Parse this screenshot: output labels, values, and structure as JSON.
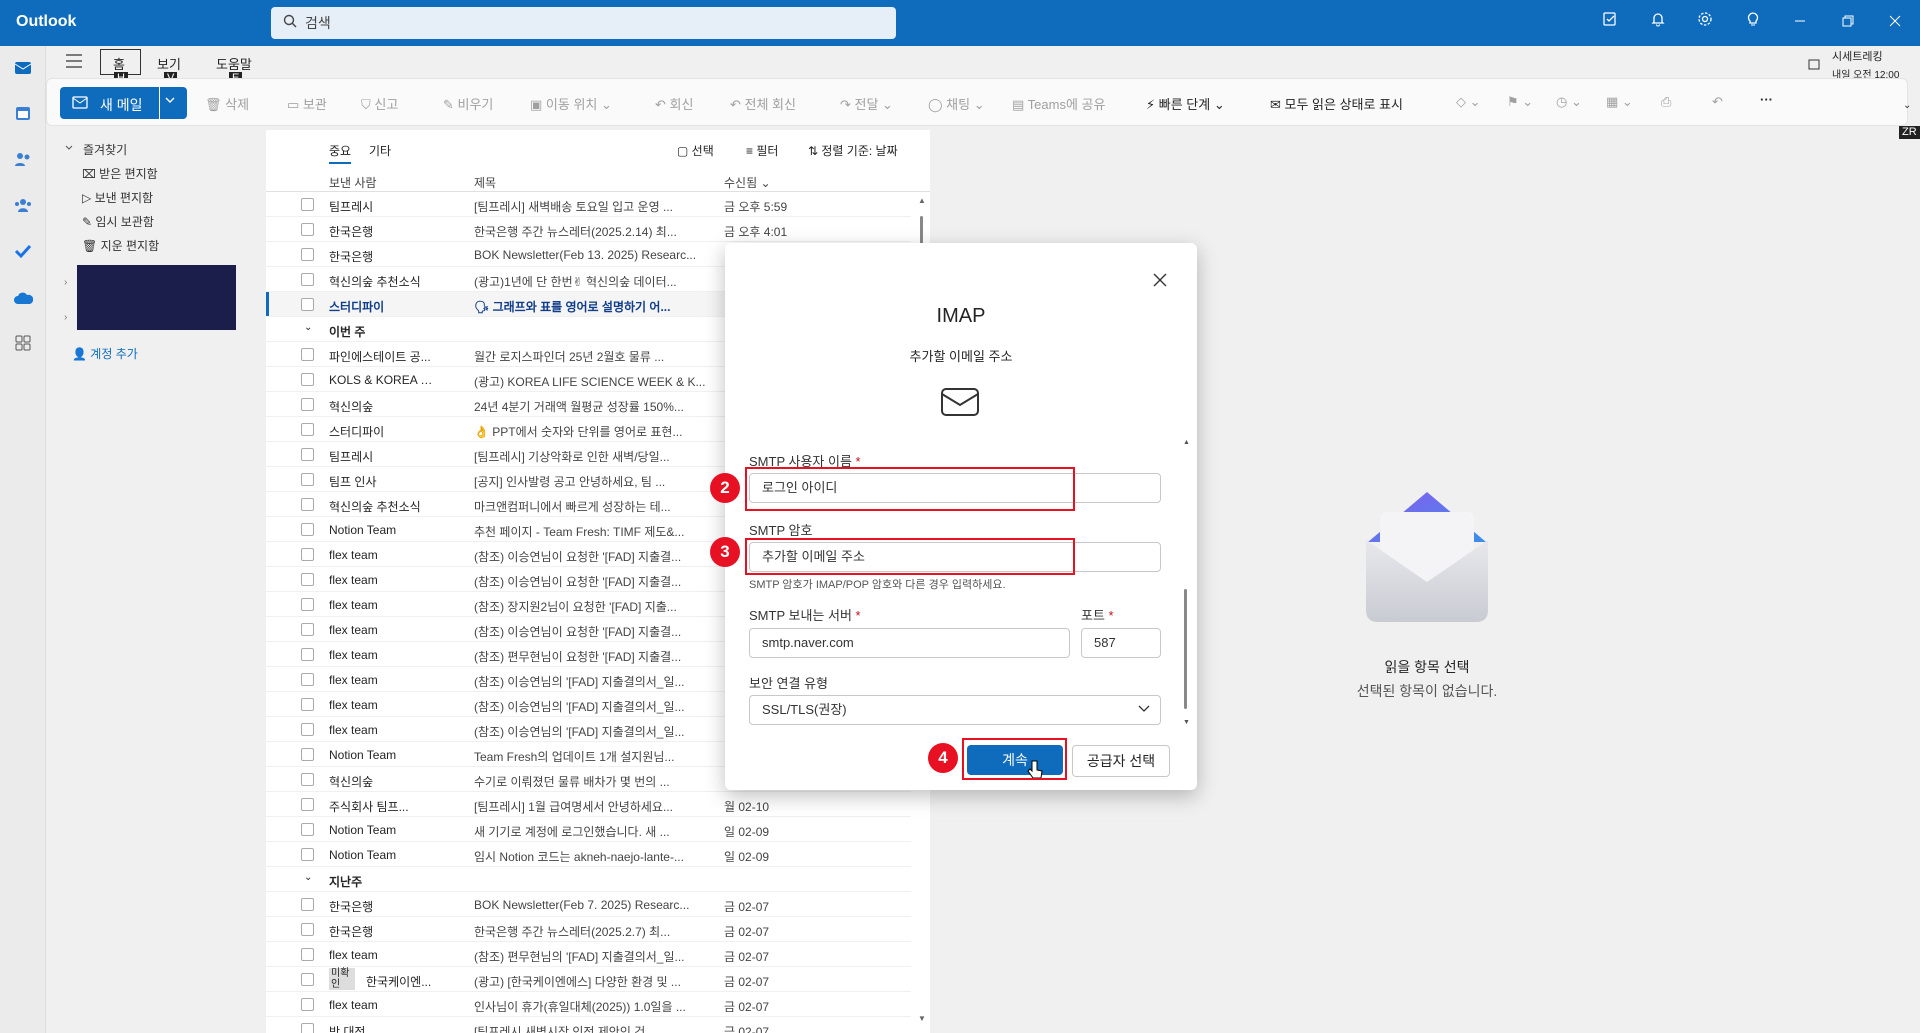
{
  "app": {
    "title": "Outlook"
  },
  "search": {
    "placeholder": "검색"
  },
  "titlebar_icons": [
    "notes-icon",
    "bell-icon",
    "gear-icon",
    "lightbulb-icon",
    "minimize-icon",
    "restore-icon",
    "close-icon"
  ],
  "menu": {
    "home": "홈",
    "home_key": "H",
    "view": "보기",
    "view_key": "V",
    "help": "도움말",
    "help_key": "E",
    "event": "시세트레킹",
    "event_time": "내일 오전 12:00",
    "event_key": "TU",
    "zr_key": "ZR"
  },
  "ribbon": {
    "new_mail": "새 메일",
    "delete": "삭제",
    "archive": "보관",
    "report": "신고",
    "sweep": "비우기",
    "move": "이동 위치",
    "reply": "회신",
    "reply_all": "전체 회신",
    "forward": "전달",
    "chat": "채팅",
    "teams": "Teams에 공유",
    "quick_steps": "빠른 단계",
    "mark_read": "모두 읽은 상태로 표시"
  },
  "folders": {
    "favorites": "즐겨찾기",
    "inbox": "받은 편지함",
    "sent": "보낸 편지함",
    "drafts": "임시 보관함",
    "deleted": "지운 편지함",
    "add_account": "계정 추가"
  },
  "list": {
    "tab_focused": "중요",
    "tab_other": "기타",
    "select": "선택",
    "filter": "필터",
    "sort": "정렬 기준: 날짜",
    "col_from": "보낸 사람",
    "col_subject": "제목",
    "col_received": "수신됨"
  },
  "rows": [
    {
      "from": "팀프레시",
      "subject": "[팀프레시] 새벽배송 토요일 입고 운영 ...",
      "date": "금 오후 5:59"
    },
    {
      "from": "한국은행",
      "subject": "한국은행 주간 뉴스레터(2025.2.14) 최...",
      "date": "금 오후 4:01"
    },
    {
      "from": "한국은행",
      "subject": "BOK Newsletter(Feb 13. 2025) Researc...",
      "date": ""
    },
    {
      "from": "혁신의숲 추천소식",
      "subject": "(광고)1년에 단 한번✌ 혁신의숲 데이터...",
      "date": ""
    },
    {
      "from": "스터디파이",
      "subject": "🗣 그래프와 표를 영어로 설명하기 어...",
      "date": "",
      "sel": true
    },
    {
      "group": "이번 주"
    },
    {
      "from": "파인에스테이트 공...",
      "subject": "월간 로지스파인더 25년 2월호 물류 ...",
      "date": ""
    },
    {
      "from": "KOLS & KOREA LA...",
      "subject": "(광고) KOREA LIFE SCIENCE WEEK & K...",
      "date": ""
    },
    {
      "from": "혁신의숲",
      "subject": "24년 4분기 거래액 월평균 성장률 150%...",
      "date": ""
    },
    {
      "from": "스터디파이",
      "subject": "👌 PPT에서 숫자와 단위를 영어로 표현...",
      "date": ""
    },
    {
      "from": "팀프레시",
      "subject": "[팀프레시] 기상악화로 인한 새벽/당일...",
      "date": ""
    },
    {
      "from": "팀프 인사",
      "subject": "[공지] 인사발령 공고 안녕하세요, 팀 ...",
      "date": ""
    },
    {
      "from": "혁신의숲 추천소식",
      "subject": "마크앤컴퍼니에서 빠르게 성장하는 테...",
      "date": ""
    },
    {
      "from": "Notion Team",
      "subject": "추천 페이지 - Team Fresh: TIMF 제도&...",
      "date": ""
    },
    {
      "from": "flex team",
      "subject": "(참조) 이승연님이 요청한 '[FAD] 지출결...",
      "date": ""
    },
    {
      "from": "flex team",
      "subject": "(참조) 이승연님이 요청한 '[FAD] 지출결...",
      "date": ""
    },
    {
      "from": "flex team",
      "subject": "(참조) 장지원2님이 요청한 '[FAD] 지출...",
      "date": ""
    },
    {
      "from": "flex team",
      "subject": "(참조) 이승연님이 요청한 '[FAD] 지출결...",
      "date": ""
    },
    {
      "from": "flex team",
      "subject": "(참조) 편무현님이 요청한 '[FAD] 지출결...",
      "date": ""
    },
    {
      "from": "flex team",
      "subject": "(참조) 이승연님의 '[FAD] 지출결의서_일...",
      "date": ""
    },
    {
      "from": "flex team",
      "subject": "(참조) 이승연님의 '[FAD] 지출결의서_일...",
      "date": ""
    },
    {
      "from": "flex team",
      "subject": "(참조) 이승연님의 '[FAD] 지출결의서_일...",
      "date": ""
    },
    {
      "from": "Notion Team",
      "subject": "Team Fresh의 업데이트 1개 설지원님...",
      "date": ""
    },
    {
      "from": "혁신의숲",
      "subject": "수기로 이뤄졌던 물류 배차가 몇 번의 ...",
      "date": ""
    },
    {
      "from": "주식회사 팀프...",
      "subject": "[팀프레시] 1월 급여명세서 안녕하세요...",
      "date": "월 02-10"
    },
    {
      "from": "Notion Team",
      "subject": "새 기기로 계정에 로그인했습니다. 새 ...",
      "date": "일 02-09"
    },
    {
      "from": "Notion Team",
      "subject": "임시 Notion 코드는 akneh-naejo-lante-...",
      "date": "일 02-09"
    },
    {
      "group": "지난주"
    },
    {
      "from": "한국은행",
      "subject": "BOK Newsletter(Feb 7. 2025) Researc...",
      "date": "금 02-07"
    },
    {
      "from": "한국은행",
      "subject": "한국은행 주간 뉴스레터(2025.2.7) 최...",
      "date": "금 02-07"
    },
    {
      "from": "flex team",
      "subject": "(참조) 편무현님의 '[FAD] 지출결의서_일...",
      "date": "금 02-07"
    },
    {
      "from": "한국케이엔...",
      "subject": "(광고) [한국케이엔에스] 다양한 환경 및 ...",
      "date": "금 02-07",
      "unconfirmed": "미확인"
    },
    {
      "from": "flex team",
      "subject": "인사님이 휴가(휴일대체(2025)) 1.0일을 ...",
      "date": "금 02-07"
    },
    {
      "from": "박 대전",
      "subject": "[팀프레시 새벽시작 인전 제안인 건",
      "date": "금 02-07"
    }
  ],
  "reading": {
    "empty_title": "읽을 항목 선택",
    "empty_sub": "선택된 항목이 없습니다."
  },
  "dialog": {
    "title": "IMAP",
    "subtitle": "추가할 이메일 주소",
    "smtp_user_label": "SMTP 사용자 이름",
    "smtp_user_value": "로그인 아이디",
    "smtp_pass_label": "SMTP 암호",
    "smtp_pass_value": "추가할 이메일 주소",
    "smtp_pass_hint": "SMTP 암호가 IMAP/POP 암호와 다른 경우 입력하세요.",
    "smtp_server_label": "SMTP 보내는 서버",
    "smtp_server_value": "smtp.naver.com",
    "port_label": "포트",
    "port_value": "587",
    "security_label": "보안 연결 유형",
    "security_value": "SSL/TLS(권장)",
    "continue": "계속",
    "choose_provider": "공급자 선택",
    "required_mark": "*"
  },
  "annotations": {
    "step2": "2",
    "step3": "3",
    "step4": "4"
  },
  "colors": {
    "accent": "#0f6cbd",
    "annotation_red": "#e81123"
  }
}
